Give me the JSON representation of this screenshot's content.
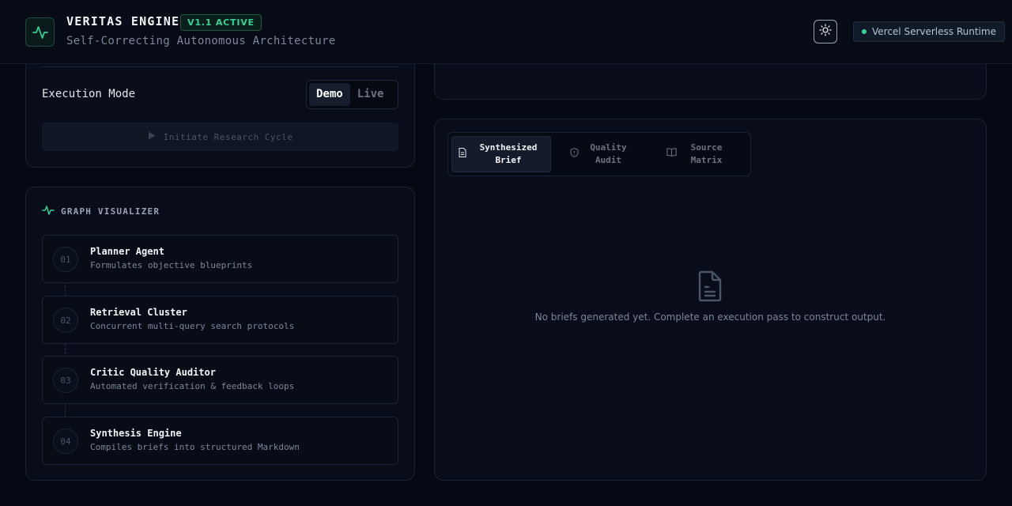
{
  "header": {
    "title": "VERITAS ENGINE",
    "version_badge": "V1.1 ACTIVE",
    "subtitle": "Self-Correcting Autonomous Architecture",
    "runtime_badge": "Vercel Serverless Runtime"
  },
  "controls": {
    "execution_mode_label": "Execution Mode",
    "mode_options": [
      "Demo",
      "Live"
    ],
    "selected_mode": "Demo",
    "initiate_button": "Initiate Research Cycle"
  },
  "graph": {
    "title": "GRAPH VISUALIZER",
    "nodes": [
      {
        "num": "01",
        "title": "Planner Agent",
        "desc": "Formulates objective blueprints"
      },
      {
        "num": "02",
        "title": "Retrieval Cluster",
        "desc": "Concurrent multi-query search protocols"
      },
      {
        "num": "03",
        "title": "Critic Quality Auditor",
        "desc": "Automated verification & feedback loops"
      },
      {
        "num": "04",
        "title": "Synthesis Engine",
        "desc": "Compiles briefs into structured Markdown"
      }
    ]
  },
  "output": {
    "tabs": [
      {
        "label": "Synthesized Brief",
        "icon": "document-icon",
        "active": true
      },
      {
        "label": "Quality Audit",
        "icon": "shield-icon",
        "active": false
      },
      {
        "label": "Source Matrix",
        "icon": "book-icon",
        "active": false
      }
    ],
    "empty_state": "No briefs generated yet. Complete an execution pass to construct output."
  },
  "colors": {
    "accent": "#34d399",
    "background": "#050913",
    "panel": "#080d19",
    "border": "#1a2333"
  }
}
